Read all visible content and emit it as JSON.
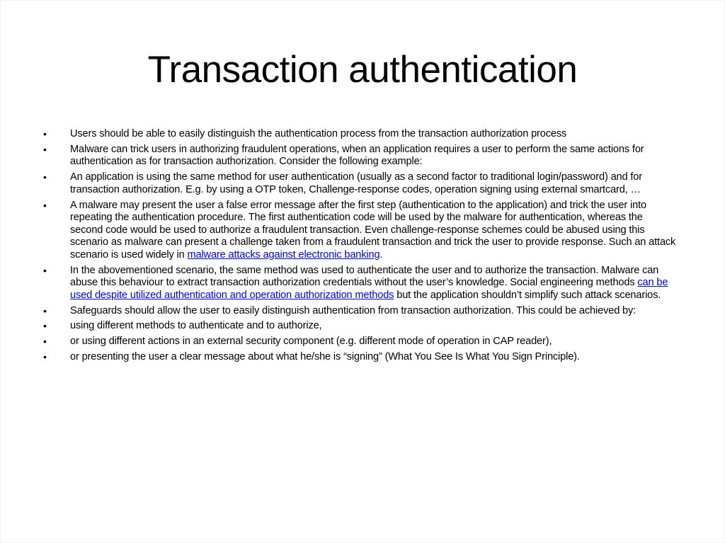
{
  "slide": {
    "title": "Transaction authentication",
    "link_color": "#0000ee",
    "bullet_glyph": "•",
    "bullets": [
      {
        "before": "Users should be able to easily distinguish the authentication process from the transaction authorization process",
        "link": "",
        "after": ""
      },
      {
        "before": "Malware can trick users in authorizing fraudulent operations, when an application requires a user to perform the same actions for authentication as for transaction authorization. Consider the following example:",
        "link": "",
        "after": ""
      },
      {
        "before": "An application is using the same method for user authentication (usually as a second factor to traditional login/password) and for transaction authorization. E.g. by using a OTP token, Challenge-response codes, operation signing using external smartcard, …",
        "link": "",
        "after": ""
      },
      {
        "before": "A malware may present the user a false error message after the first step (authentication to the application) and trick the user into repeating the authentication procedure. The first authentication code will be used by the malware for authentication, whereas the second code would be used to authorize a fraudulent transaction. Even challenge-response schemes could be abused using this scenario as malware can present a challenge taken from a fraudulent transaction and trick the user to provide response. Such an attack scenario is used widely in ",
        "link": "malware attacks against electronic banking",
        "after": "."
      },
      {
        "before": "In the abovementioned scenario, the same method was used to authenticate the user and to authorize the transaction. Malware can abuse this behaviour to extract transaction authorization credentials without the user’s knowledge. Social engineering methods ",
        "link": "can be used despite utilized authentication and operation authorization methods",
        "after": " but the application shouldn’t simplify such attack scenarios."
      },
      {
        "before": "Safeguards should allow the user to easily distinguish authentication from transaction authorization. This could be achieved by:",
        "link": "",
        "after": ""
      },
      {
        "before": "using different methods to authenticate and to authorize,",
        "link": "",
        "after": ""
      },
      {
        "before": "or using different actions in an external security component (e.g. different mode of operation in CAP reader),",
        "link": "",
        "after": ""
      },
      {
        "before": "or presenting the user a clear message about what he/she is “signing” (What You See Is What You Sign Principle).",
        "link": "",
        "after": ""
      }
    ]
  }
}
